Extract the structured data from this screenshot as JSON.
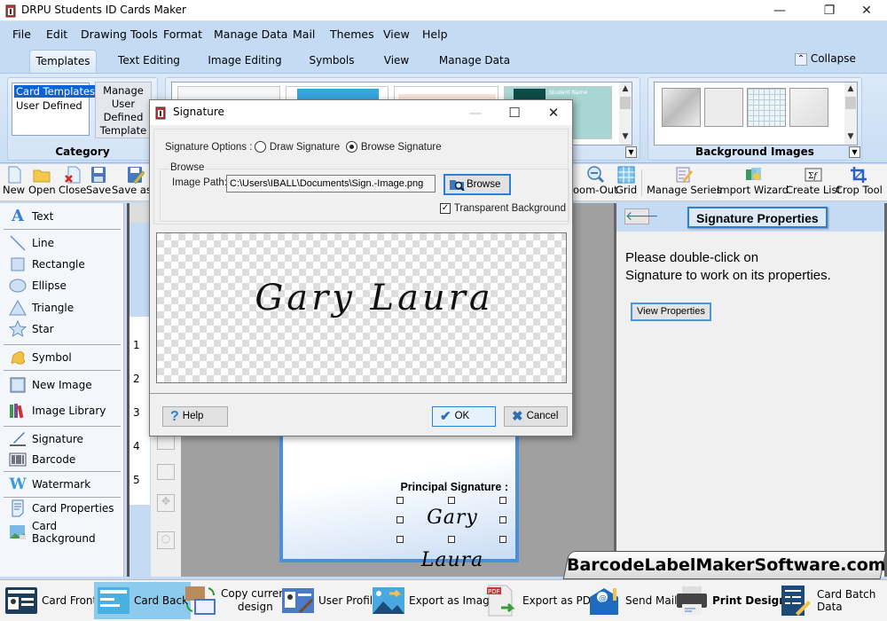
{
  "window": {
    "title": "DRPU Students ID Cards Maker",
    "controls": {
      "minimize": "—",
      "restore": "❐",
      "close": "✕"
    }
  },
  "menubar": {
    "items": [
      {
        "label": "File",
        "accel": "F"
      },
      {
        "label": "Edit",
        "accel": "E"
      },
      {
        "label": "Drawing Tools",
        "accel": "D"
      },
      {
        "label": "Format",
        "accel": "F"
      },
      {
        "label": "Manage Data",
        "accel": "M"
      },
      {
        "label": "Mail",
        "accel": "M"
      },
      {
        "label": "Themes",
        "accel": ""
      },
      {
        "label": "View",
        "accel": "V"
      },
      {
        "label": "Help",
        "accel": "H"
      }
    ]
  },
  "ribbon_tabs": {
    "items": [
      "Templates",
      "Text Editing",
      "Image Editing",
      "Symbols",
      "View",
      "Manage Data"
    ],
    "active": "Templates",
    "collapse_label": "Collapse"
  },
  "ribbon": {
    "category": {
      "label": "Category",
      "list": [
        "Card Templates",
        "User Defined"
      ],
      "selected": "Card Templates",
      "manage_button": [
        "Manage",
        "User",
        "Defined",
        "Template"
      ]
    },
    "templates_thumbnail_text": "Student Name",
    "background_images": {
      "label": "Background Images"
    }
  },
  "toolbar": {
    "items": [
      {
        "label": "New",
        "icon": "new-file-icon"
      },
      {
        "label": "Open",
        "icon": "open-folder-icon"
      },
      {
        "label": "Close",
        "icon": "close-file-icon"
      },
      {
        "label": "Save",
        "icon": "save-icon"
      },
      {
        "label": "Save as I",
        "icon": "save-as-icon"
      },
      {
        "label": "oom-Out",
        "icon": "zoom-out-icon"
      },
      {
        "label": "Grid",
        "icon": "grid-icon"
      },
      {
        "label": "Manage Series",
        "icon": "manage-series-icon"
      },
      {
        "label": "Import Wizard",
        "icon": "import-wizard-icon"
      },
      {
        "label": "Create List",
        "icon": "create-list-icon"
      },
      {
        "label": "Crop Tool",
        "icon": "crop-tool-icon"
      }
    ]
  },
  "left_panel": {
    "items": [
      {
        "label": "Text",
        "icon": "text-icon"
      },
      {
        "label": "Line",
        "icon": "line-icon"
      },
      {
        "label": "Rectangle",
        "icon": "rectangle-icon"
      },
      {
        "label": "Ellipse",
        "icon": "ellipse-icon"
      },
      {
        "label": "Triangle",
        "icon": "triangle-icon"
      },
      {
        "label": "Star",
        "icon": "star-icon"
      },
      {
        "label": "Symbol",
        "icon": "symbol-icon"
      },
      {
        "label": "New Image",
        "icon": "new-image-icon"
      },
      {
        "label": "Image Library",
        "icon": "image-library-icon"
      },
      {
        "label": "Signature",
        "icon": "signature-icon"
      },
      {
        "label": "Barcode",
        "icon": "barcode-icon"
      },
      {
        "label": "Watermark",
        "icon": "watermark-icon"
      },
      {
        "label": "Card Properties",
        "icon": "card-properties-icon"
      },
      {
        "label": "Card Background",
        "icon": "card-background-icon"
      }
    ]
  },
  "ruler": {
    "labels": [
      "1",
      "2",
      "3",
      "4",
      "5"
    ]
  },
  "card": {
    "principal_label": "Principal Signature :",
    "signature_text": "Gary Laura"
  },
  "right_panel": {
    "title": "Signature Properties",
    "message_line1": "Please double-click on",
    "message_line2": "Signature to work on its properties.",
    "view_properties_button": "View Properties"
  },
  "dialog": {
    "title": "Signature",
    "signature_options_label": "Signature Options :",
    "options": [
      {
        "label": "Draw Signature",
        "selected": false
      },
      {
        "label": "Browse Signature",
        "selected": true
      }
    ],
    "browse_group_label": "Browse",
    "image_path_label": "Image Path:",
    "image_path_value": "C:\\Users\\IBALL\\Documents\\Sign.-Image.png",
    "browse_button": "Browse",
    "transparent_background_label": "Transparent Background",
    "transparent_background_checked": true,
    "preview_signature_text": "Gary Laura",
    "help_button": "Help",
    "ok_button": "OK",
    "cancel_button": "Cancel"
  },
  "watermark_text": "BarcodeLabelMakerSoftware.com",
  "bottom_bar": {
    "items": [
      {
        "label": "Card Front",
        "icon": "card-front-icon",
        "active": false
      },
      {
        "label": "Card Back",
        "icon": "card-back-icon",
        "active": true
      },
      {
        "label": "Copy current design",
        "label_line1": "Copy current",
        "label_line2": "design",
        "icon": "copy-design-icon",
        "active": false
      },
      {
        "label": "User Profile",
        "icon": "user-profile-icon",
        "active": false
      },
      {
        "label": "Export as Image",
        "icon": "export-image-icon",
        "active": false
      },
      {
        "label": "Export as PDF",
        "icon": "export-pdf-icon",
        "active": false
      },
      {
        "label": "Send Mail",
        "icon": "send-mail-icon",
        "active": false
      },
      {
        "label": "Print Design",
        "icon": "printer-icon",
        "active": false
      },
      {
        "label": "Card Batch Data",
        "icon": "batch-data-icon",
        "active": false
      }
    ]
  },
  "colors": {
    "accent_blue": "#2a80d8",
    "ribbon_bg": "#c4dbf3",
    "selection": "#0a64d6",
    "active_bottom": "#8ccbec"
  }
}
